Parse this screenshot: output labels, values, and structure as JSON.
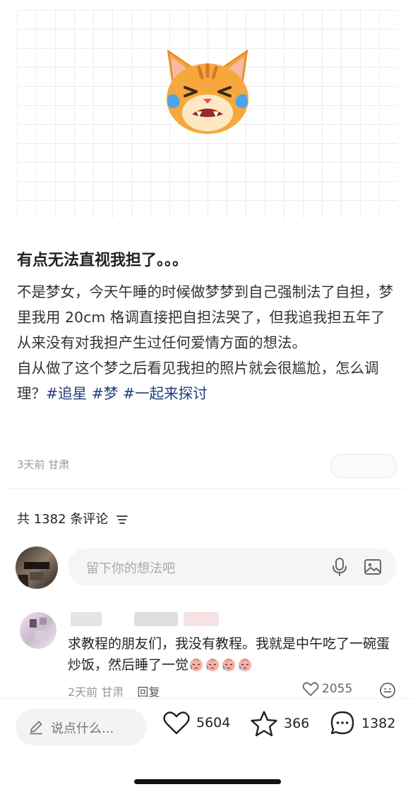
{
  "post": {
    "hero_icon": "crying-cat-face-emoji",
    "title": "有点无法直视我担了。。。",
    "body_line1": "不是梦女，今天午睡的时候做梦梦到自己强制法了自担，梦里我用 20cm 格调直接把自担法哭了，但我追我担五年了从来没有对我担产生过任何爱情方面的想法。",
    "body_line2": "自从做了这个梦之后看见我担的照片就会很尴尬，怎么调理？",
    "hashtags": [
      "#追星",
      "#梦",
      "#一起来探讨"
    ],
    "meta": "3天前 甘肃"
  },
  "comments_section": {
    "count_label": "共 1382 条评论",
    "filter_icon": "sort-icon",
    "input_placeholder": "留下你的想法吧",
    "input_icons": [
      "microphone-icon",
      "image-icon"
    ]
  },
  "comment": {
    "text": "求教程的朋友们，我没有教程。我就是中午吃了一碗蛋炒饭，然后睡了一觉",
    "emoji": "crying-face-emoji",
    "emoji_count": 4,
    "time_location": "2天前 甘肃",
    "reply_label": "回复",
    "likes": "2055"
  },
  "bottom_bar": {
    "say_placeholder": "说点什么...",
    "likes": "5604",
    "collects": "366",
    "comments": "1382"
  },
  "colors": {
    "hashtag": "#1f3d78",
    "placeholder": "#a8a8a8",
    "meta": "#9a9a9a"
  }
}
